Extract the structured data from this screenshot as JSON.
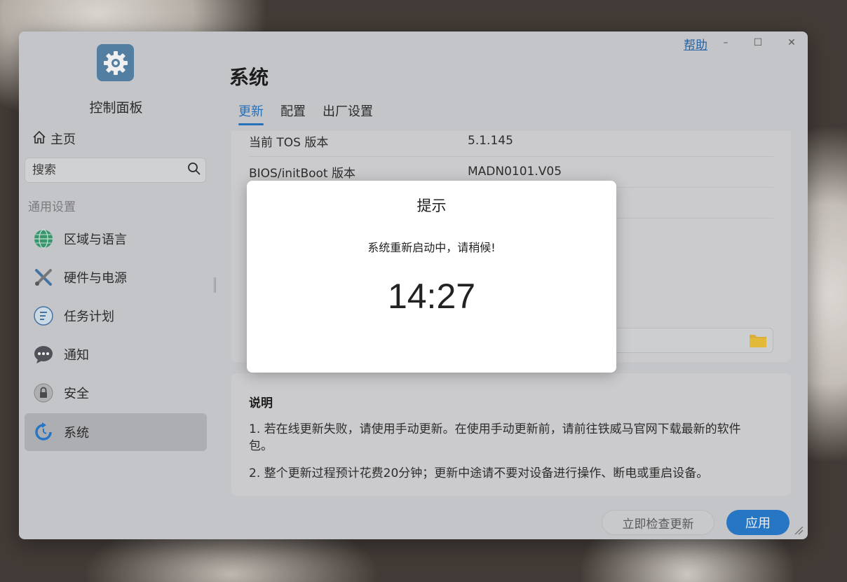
{
  "window": {
    "help_label": "帮助",
    "minimize_label": "–",
    "maximize_label": "☐",
    "close_label": "✕"
  },
  "sidebar": {
    "app_title": "控制面板",
    "home_label": "主页",
    "search_placeholder": "搜索",
    "section_label": "通用设置",
    "items": [
      {
        "label": "区域与语言",
        "icon": "globe-icon"
      },
      {
        "label": "硬件与电源",
        "icon": "tools-icon"
      },
      {
        "label": "任务计划",
        "icon": "task-list-icon"
      },
      {
        "label": "通知",
        "icon": "chat-bubble-icon"
      },
      {
        "label": "安全",
        "icon": "lock-icon"
      },
      {
        "label": "系统",
        "icon": "system-refresh-icon",
        "active": true
      }
    ]
  },
  "main": {
    "title": "系统",
    "tabs": [
      {
        "label": "更新",
        "active": true
      },
      {
        "label": "配置"
      },
      {
        "label": "出厂设置"
      }
    ],
    "info_rows": [
      {
        "key": "当前 TOS 版本",
        "value": "5.1.145"
      },
      {
        "key": "BIOS/initBoot 版本",
        "value": "MADN0101.V05"
      }
    ],
    "notes": {
      "title": "说明",
      "line1": "1. 若在线更新失败，请使用手动更新。在使用手动更新前，请前往铁威马官网下载最新的软件",
      "line1b": "包。",
      "line2": "2. 整个更新过程预计花费20分钟；更新中途请不要对设备进行操作、断电或重启设备。"
    },
    "buttons": {
      "check_update": "立即检查更新",
      "apply": "应用"
    }
  },
  "modal": {
    "title": "提示",
    "message": "系统重新启动中，请稍候!",
    "timer": "14:27"
  },
  "colors": {
    "accent": "#1b76cf",
    "window_bg": "#cfd0d3",
    "folder": "#e8b52e"
  }
}
